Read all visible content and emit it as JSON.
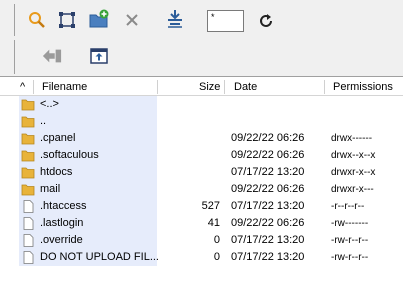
{
  "toolbar": {
    "row1": [
      {
        "name": "find-files-icon"
      },
      {
        "name": "select-area-icon"
      },
      {
        "name": "new-folder-icon"
      },
      {
        "name": "delete-icon"
      },
      {
        "name": "filter-icon"
      },
      {
        "name": "refresh-icon"
      }
    ],
    "filter_value": "*",
    "row2": [
      {
        "name": "back-icon"
      },
      {
        "name": "parent-directory-icon"
      }
    ],
    "path": "/"
  },
  "columns": {
    "sort_indicator": "^",
    "name": "Filename",
    "size": "Size",
    "date": "Date",
    "permissions": "Permissions"
  },
  "files": [
    {
      "name": "<..>",
      "type": "folder",
      "size": "",
      "date": "",
      "permissions": ""
    },
    {
      "name": "..",
      "type": "folder",
      "size": "",
      "date": "",
      "permissions": ""
    },
    {
      "name": ".cpanel",
      "type": "folder",
      "size": "",
      "date": "09/22/22  06:26",
      "permissions": "drwx------"
    },
    {
      "name": ".softaculous",
      "type": "folder",
      "size": "",
      "date": "09/22/22  06:26",
      "permissions": "drwx--x--x"
    },
    {
      "name": "htdocs",
      "type": "folder",
      "size": "",
      "date": "07/17/22  13:20",
      "permissions": "drwxr-x--x"
    },
    {
      "name": "mail",
      "type": "folder",
      "size": "",
      "date": "09/22/22  06:26",
      "permissions": "drwxr-x---"
    },
    {
      "name": ".htaccess",
      "type": "file",
      "size": "527",
      "date": "07/17/22  13:20",
      "permissions": "-r--r--r--"
    },
    {
      "name": ".lastlogin",
      "type": "file",
      "size": "41",
      "date": "09/22/22  06:26",
      "permissions": "-rw-------"
    },
    {
      "name": ".override",
      "type": "file",
      "size": "0",
      "date": "07/17/22  13:20",
      "permissions": "-rw-r--r--"
    },
    {
      "name": "DO NOT UPLOAD FIL...",
      "type": "file",
      "size": "0",
      "date": "07/17/22  13:20",
      "permissions": "-rw-r--r--"
    }
  ],
  "colors": {
    "folder": "#e8b33a",
    "selection": "#e6ecfb"
  }
}
